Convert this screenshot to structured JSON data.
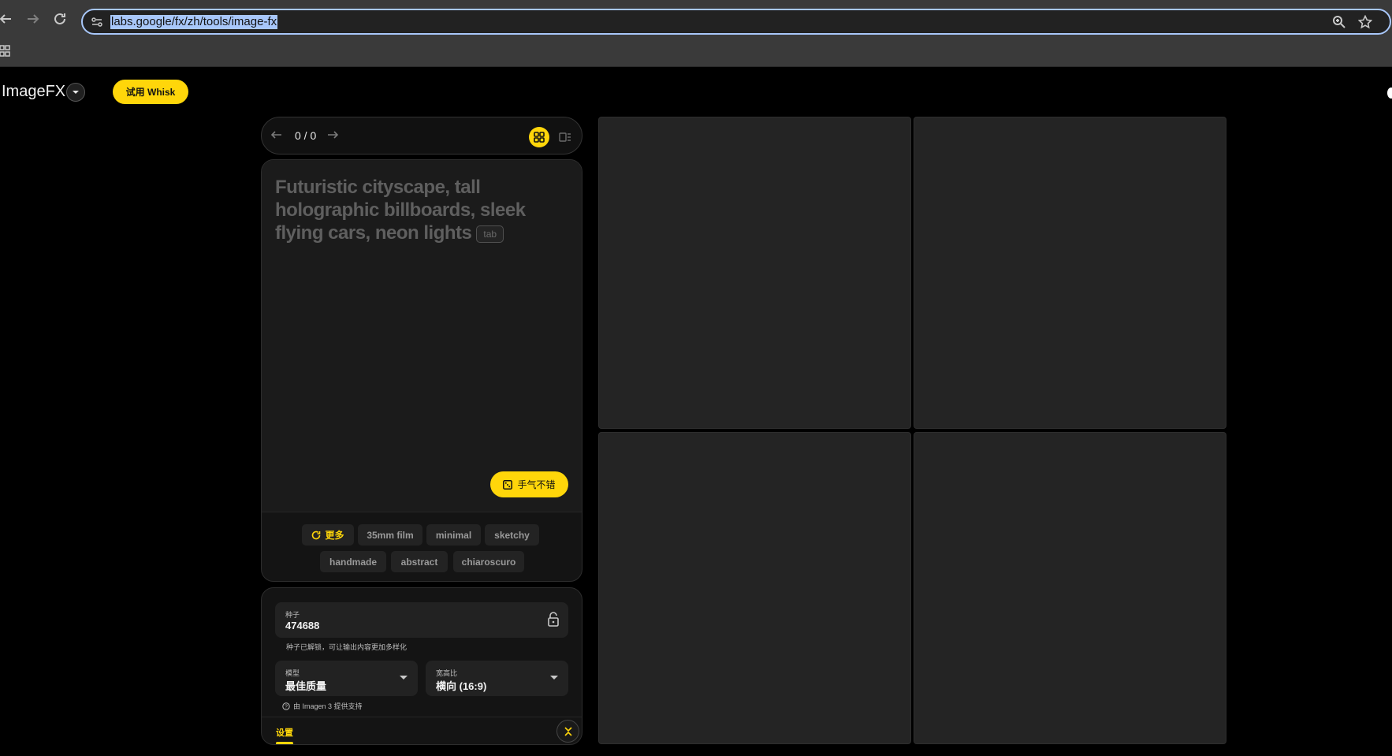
{
  "browser": {
    "url": "labs.google/fx/zh/tools/image-fx",
    "back_icon": "arrow-left-icon",
    "forward_icon": "arrow-right-icon",
    "reload_icon": "reload-icon",
    "zoom_icon": "zoom-icon",
    "bookmark_icon": "star-icon",
    "apps_icon": "apps-grid-icon"
  },
  "header": {
    "title": "ImageFX",
    "whisk_button": "试用 Whisk"
  },
  "pager": {
    "count": "0 / 0"
  },
  "prompt": {
    "placeholder": "Futuristic cityscape, tall holographic billboards, sleek flying cars, neon lights",
    "tab_hint": "tab",
    "lucky_button": "手气不错"
  },
  "chips": {
    "more": "更多",
    "items": [
      "35mm film",
      "minimal",
      "sketchy",
      "handmade",
      "abstract",
      "chiaroscuro"
    ]
  },
  "settings": {
    "seed_label": "种子",
    "seed_value": "474688",
    "seed_help": "种子已解锁，可让输出内容更加多样化",
    "model_label": "模型",
    "model_value": "最佳质量",
    "aspect_label": "宽高比",
    "aspect_value": "横向 (16:9)",
    "powered_by": "由 Imagen 3 提供支持",
    "tab_label": "设置"
  },
  "colors": {
    "accent": "#ffd60a",
    "background": "#000000",
    "tile": "#242424"
  }
}
